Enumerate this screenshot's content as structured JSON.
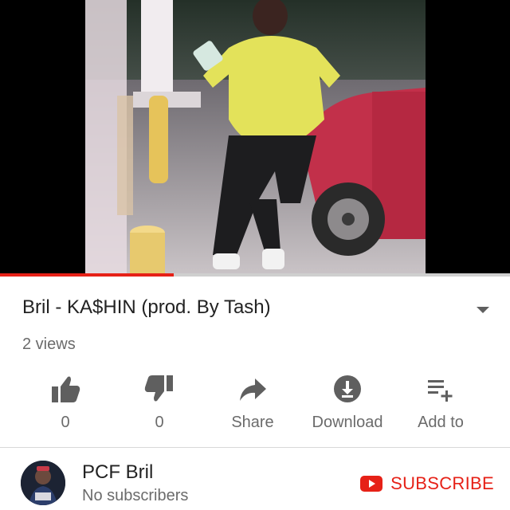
{
  "video": {
    "title": "Bril - KA$HIN (prod. By Tash)",
    "views": "2 views",
    "progress_fraction": 0.34
  },
  "actions": [
    {
      "name": "like",
      "label": "0",
      "icon": "thumbs-up-icon"
    },
    {
      "name": "dislike",
      "label": "0",
      "icon": "thumbs-down-icon"
    },
    {
      "name": "share",
      "label": "Share",
      "icon": "share-arrow-icon"
    },
    {
      "name": "download",
      "label": "Download",
      "icon": "download-icon"
    },
    {
      "name": "add-to",
      "label": "Add to",
      "icon": "playlist-add-icon"
    }
  ],
  "channel": {
    "name": "PCF Bril",
    "subscribers": "No subscribers",
    "subscribe_label": "SUBSCRIBE"
  },
  "colors": {
    "accent": "#e62117",
    "icon_gray": "#5f5f5f",
    "text_secondary": "#6b6b6b"
  }
}
